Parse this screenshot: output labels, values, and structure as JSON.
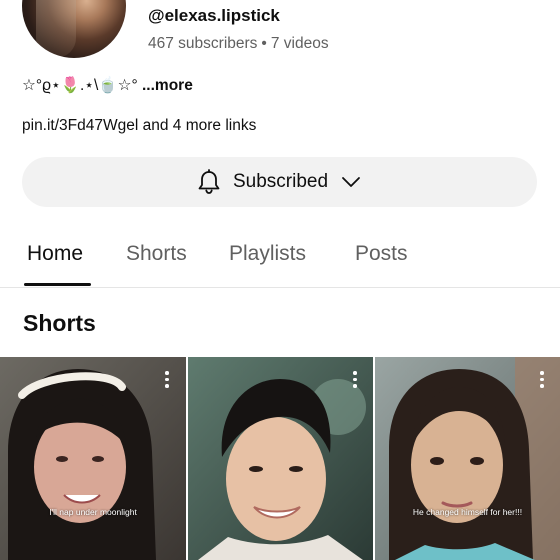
{
  "channel": {
    "handle": "@elexas.lipstick",
    "subscribers": "467 subscribers",
    "videos": "7 videos",
    "separator": "•",
    "description": "☆°ϱ⋆🌷.⋆\\🍵☆°",
    "description_more": "...more",
    "links_text": "pin.it/3Fd47Wgel and 4 more links"
  },
  "subscribe_button": {
    "label": "Subscribed",
    "icon": "bell-icon",
    "dropdown_icon": "chevron-down-icon"
  },
  "tabs": [
    {
      "label": "Home",
      "active": true
    },
    {
      "label": "Shorts",
      "active": false
    },
    {
      "label": "Playlists",
      "active": false
    },
    {
      "label": "Posts",
      "active": false
    }
  ],
  "section": {
    "title": "Shorts"
  },
  "shorts": [
    {
      "caption": "I'll nap under moonlight",
      "menu_icon": "more-vert-icon"
    },
    {
      "caption": "",
      "menu_icon": "more-vert-icon"
    },
    {
      "caption": "He changed himself for her!!!",
      "menu_icon": "more-vert-icon"
    }
  ],
  "colors": {
    "text_primary": "#0f0f0f",
    "text_secondary": "#606060",
    "button_bg": "#f2f2f2",
    "divider": "#e5e5e5"
  }
}
